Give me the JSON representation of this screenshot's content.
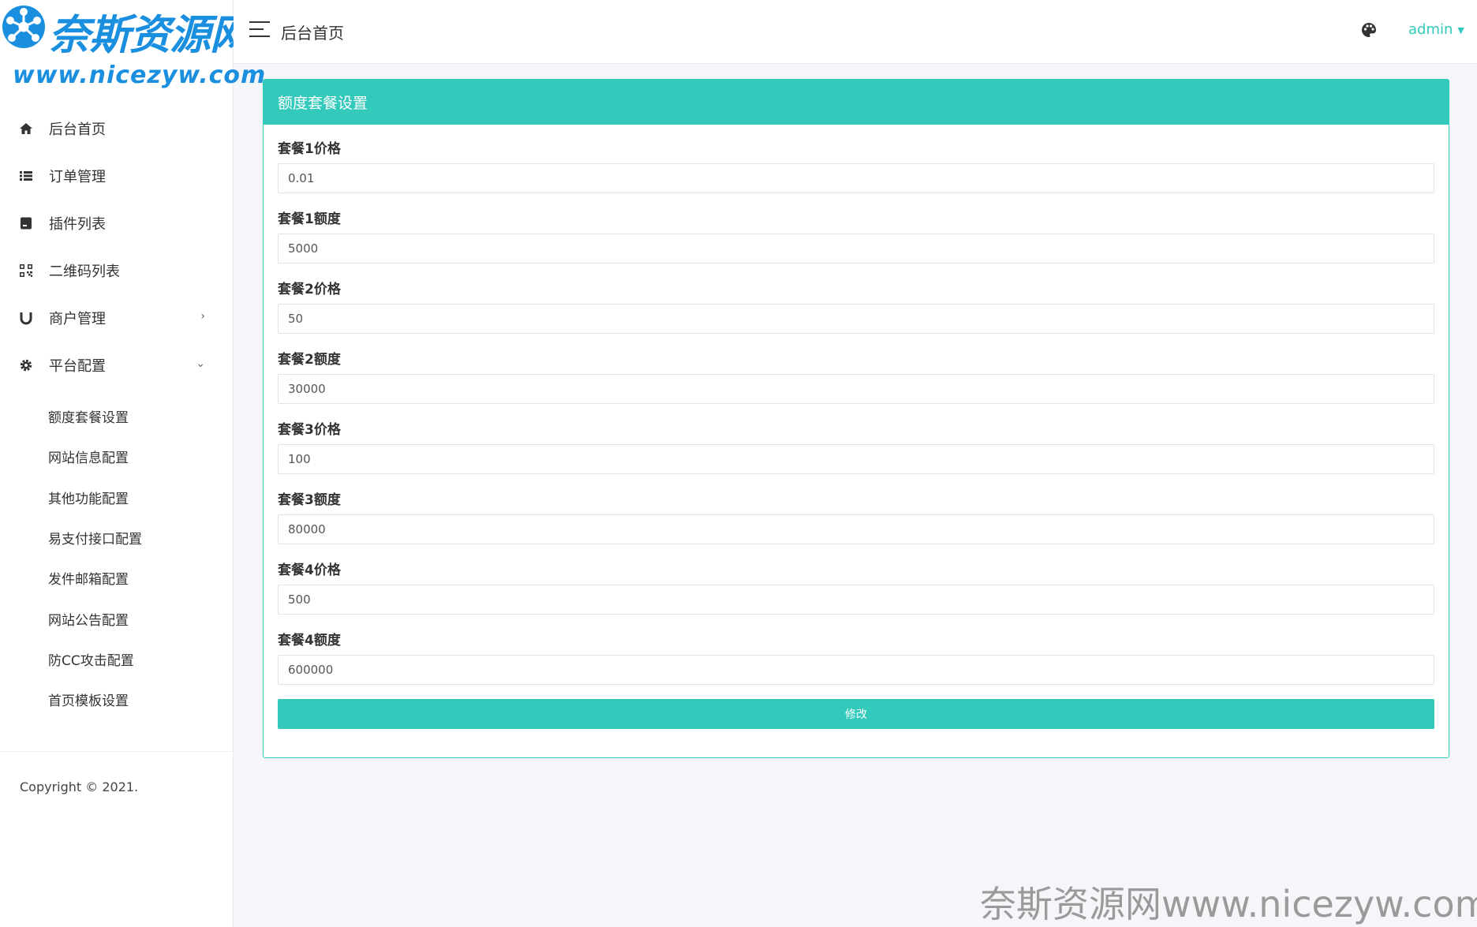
{
  "brand": {
    "name_cn": "奈斯资源网",
    "url": "www.nicezyw.com",
    "color": "#1a8fe0"
  },
  "sidebar": {
    "items": [
      {
        "label": "后台首页",
        "icon": "home-icon"
      },
      {
        "label": "订单管理",
        "icon": "list-icon"
      },
      {
        "label": "插件列表",
        "icon": "plugin-icon"
      },
      {
        "label": "二维码列表",
        "icon": "qrcode-icon"
      },
      {
        "label": "商户管理",
        "icon": "magnet-icon",
        "caret": "›"
      },
      {
        "label": "平台配置",
        "icon": "gear-icon",
        "caret": "⌄"
      }
    ],
    "subitems": [
      {
        "label": "额度套餐设置"
      },
      {
        "label": "网站信息配置"
      },
      {
        "label": "其他功能配置"
      },
      {
        "label": "易支付接口配置"
      },
      {
        "label": "发件邮箱配置"
      },
      {
        "label": "网站公告配置"
      },
      {
        "label": "防CC攻击配置"
      },
      {
        "label": "首页模板设置"
      }
    ],
    "copyright": "Copyright © 2021."
  },
  "header": {
    "title": "后台首页",
    "user": "admin"
  },
  "card": {
    "title": "额度套餐设置",
    "accent": "#33c9bb",
    "fields": [
      {
        "label": "套餐1价格",
        "value": "0.01"
      },
      {
        "label": "套餐1额度",
        "value": "5000"
      },
      {
        "label": "套餐2价格",
        "value": "50"
      },
      {
        "label": "套餐2额度",
        "value": "30000"
      },
      {
        "label": "套餐3价格",
        "value": "100"
      },
      {
        "label": "套餐3额度",
        "value": "80000"
      },
      {
        "label": "套餐4价格",
        "value": "500"
      },
      {
        "label": "套餐4额度",
        "value": "600000"
      }
    ],
    "submit_label": "修改"
  },
  "watermark": "奈斯资源网www.nicezyw.com"
}
